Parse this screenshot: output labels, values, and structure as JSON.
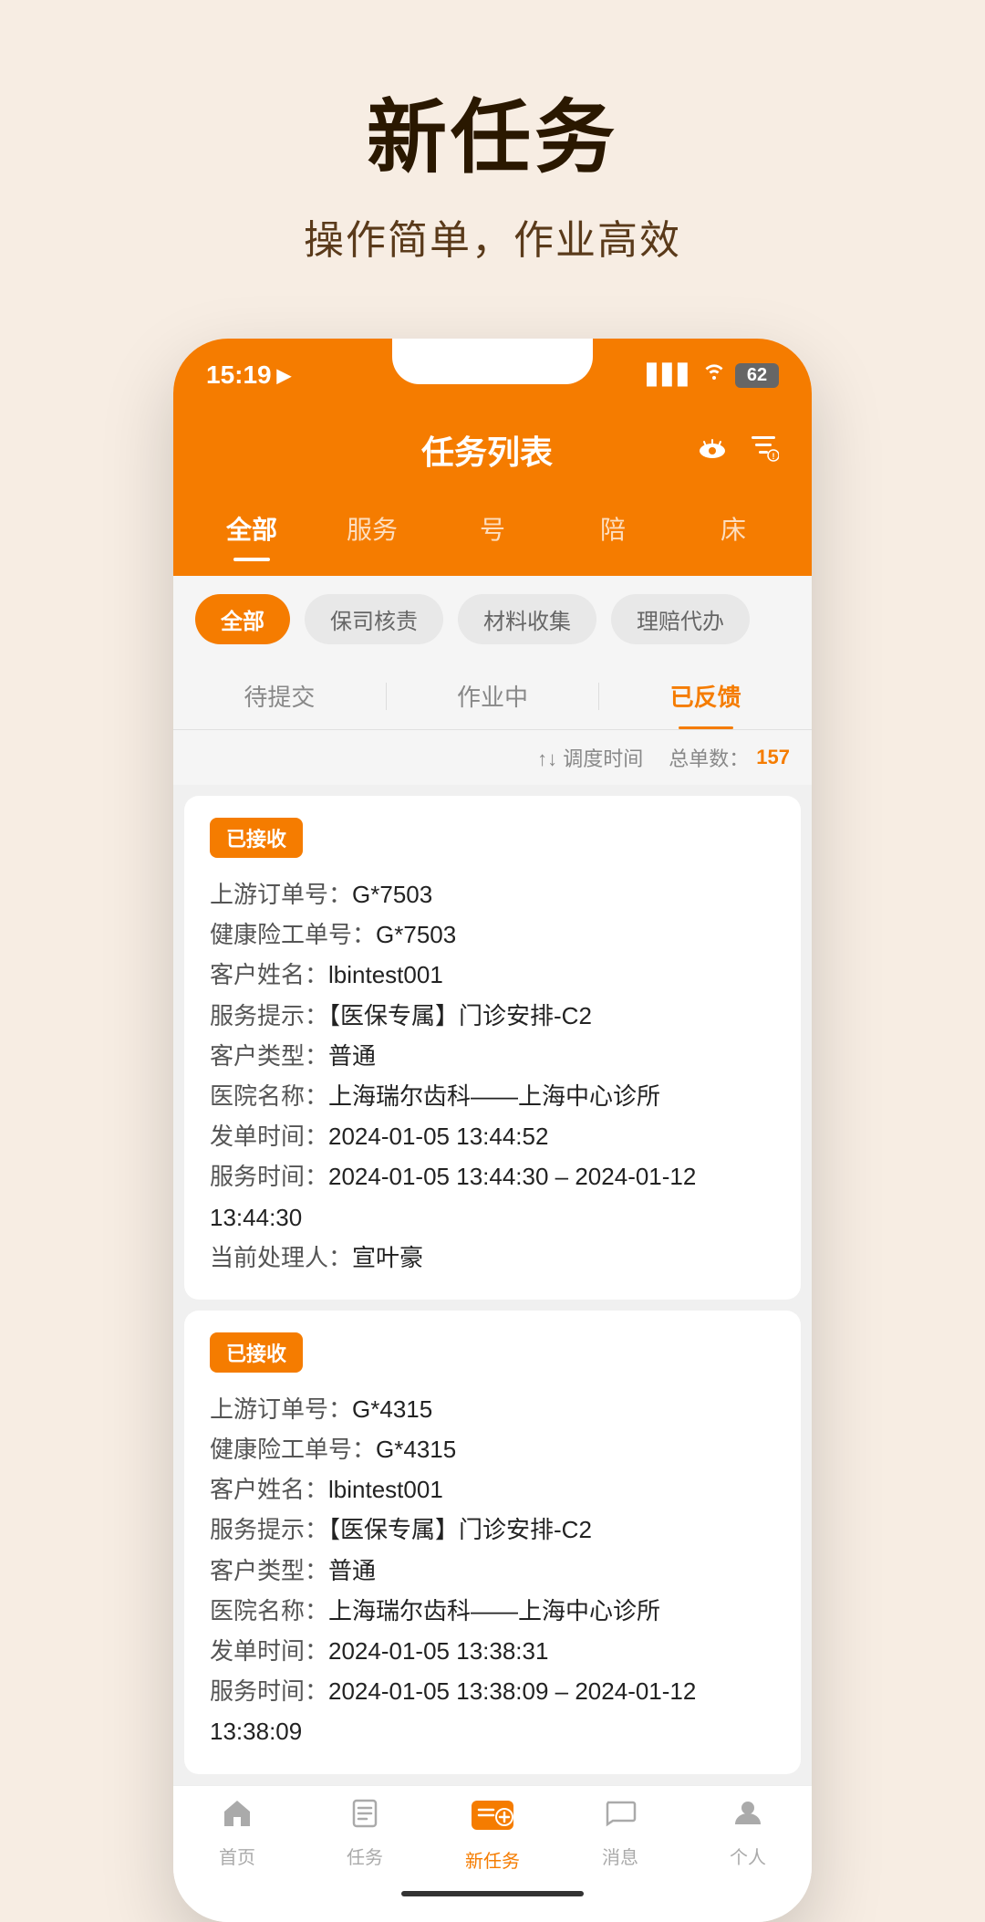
{
  "background_color": "#f7ede3",
  "page": {
    "title": "新任务",
    "subtitle": "操作简单，作业高效"
  },
  "status_bar": {
    "time": "15:19",
    "signal": "▋▋▋",
    "wifi": "WiFi",
    "battery": "62"
  },
  "app_header": {
    "title": "任务列表",
    "eye_icon": "eye",
    "filter_icon": "filter"
  },
  "main_tabs": [
    {
      "label": "全部",
      "active": true
    },
    {
      "label": "服务",
      "active": false
    },
    {
      "label": "号",
      "active": false
    },
    {
      "label": "陪",
      "active": false
    },
    {
      "label": "床",
      "active": false
    }
  ],
  "filter_chips": [
    {
      "label": "全部",
      "active": true
    },
    {
      "label": "保司核责",
      "active": false
    },
    {
      "label": "材料收集",
      "active": false
    },
    {
      "label": "理赔代办",
      "active": false
    }
  ],
  "sub_tabs": [
    {
      "label": "待提交",
      "active": false
    },
    {
      "label": "作业中",
      "active": false
    },
    {
      "label": "已反馈",
      "active": true
    }
  ],
  "sort_bar": {
    "sort_label": "↑↓ 调度时间",
    "total_label": "总单数：",
    "total_count": "157"
  },
  "task_cards": [
    {
      "status": "已接收",
      "fields": [
        {
          "label": "上游订单号：",
          "value": "G*7503"
        },
        {
          "label": "健康险工单号：",
          "value": "G*7503"
        },
        {
          "label": "客户姓名：",
          "value": "lbintest001"
        },
        {
          "label": "服务提示：",
          "value": "【医保专属】门诊安排-C2"
        },
        {
          "label": "客户类型：",
          "value": "普通"
        },
        {
          "label": "医院名称：",
          "value": "上海瑞尔齿科——上海中心诊所"
        },
        {
          "label": "发单时间：",
          "value": "2024-01-05 13:44:52"
        },
        {
          "label": "服务时间：",
          "value": "2024-01-05 13:44:30 – 2024-01-12 13:44:30"
        },
        {
          "label": "当前处理人：",
          "value": "宣叶豪"
        }
      ]
    },
    {
      "status": "已接收",
      "fields": [
        {
          "label": "上游订单号：",
          "value": "G*4315"
        },
        {
          "label": "健康险工单号：",
          "value": "G*4315"
        },
        {
          "label": "客户姓名：",
          "value": "lbintest001"
        },
        {
          "label": "服务提示：",
          "value": "【医保专属】门诊安排-C2"
        },
        {
          "label": "客户类型：",
          "value": "普通"
        },
        {
          "label": "医院名称：",
          "value": "上海瑞尔齿科——上海中心诊所"
        },
        {
          "label": "发单时间：",
          "value": "2024-01-05 13:38:31"
        },
        {
          "label": "服务时间：",
          "value": "2024-01-05 13:38:09 – 2024-01-12 13:38:09"
        }
      ]
    }
  ],
  "bottom_nav": [
    {
      "label": "首页",
      "icon": "home",
      "active": false
    },
    {
      "label": "任务",
      "icon": "task",
      "active": false
    },
    {
      "label": "新任务",
      "icon": "new-task",
      "active": true
    },
    {
      "label": "消息",
      "icon": "message",
      "active": false
    },
    {
      "label": "个人",
      "icon": "person",
      "active": false
    }
  ]
}
